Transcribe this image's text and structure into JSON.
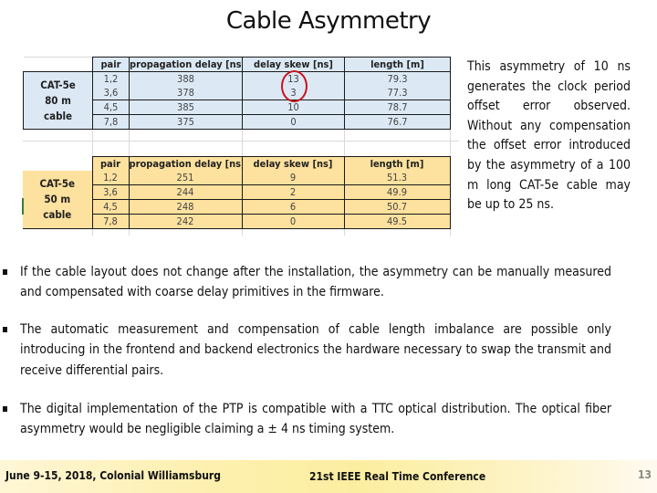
{
  "slide": {
    "title": "Cable Asymmetry",
    "page_number": "13"
  },
  "tables": {
    "cable_80m": {
      "label_lines": [
        "CAT-5e",
        "80 m",
        "cable"
      ],
      "headers": [
        "pair",
        "propagation delay [ns]",
        "delay skew [ns]",
        "length [m]"
      ],
      "rows": [
        {
          "pair": "1,2",
          "propagation_delay": "388",
          "delay_skew": "13",
          "length": "79.3"
        },
        {
          "pair": "3,6",
          "propagation_delay": "378",
          "delay_skew": "3",
          "length": "77.3"
        },
        {
          "pair": "4,5",
          "propagation_delay": "385",
          "delay_skew": "10",
          "length": "78.7"
        },
        {
          "pair": "7,8",
          "propagation_delay": "375",
          "delay_skew": "0",
          "length": "76.7"
        }
      ],
      "highlighted_cells": [
        "13",
        "3"
      ],
      "highlight_color": "#c8141c",
      "fill_color": "#dce9f5"
    },
    "cable_50m": {
      "label_lines": [
        "CAT-5e",
        "50 m",
        "cable"
      ],
      "headers": [
        "pair",
        "propagation delay [ns]",
        "delay skew [ns]",
        "length [m]"
      ],
      "rows": [
        {
          "pair": "1,2",
          "propagation_delay": "251",
          "delay_skew": "9",
          "length": "51.3"
        },
        {
          "pair": "3,6",
          "propagation_delay": "244",
          "delay_skew": "2",
          "length": "49.9"
        },
        {
          "pair": "4,5",
          "propagation_delay": "248",
          "delay_skew": "6",
          "length": "50.7"
        },
        {
          "pair": "7,8",
          "propagation_delay": "242",
          "delay_skew": "0",
          "length": "49.5"
        }
      ],
      "fill_color": "#fde19e"
    }
  },
  "side_note": "This asymmetry of 10 ns generates the clock period offset error observed. Without any compensation the offset error introduced by the asymmetry of a 100 m long CAT-5e cable may be up to 25 ns.",
  "bullets": [
    "If the cable layout does not change after the installation, the asymmetry can be manually measured and compensated with coarse delay primitives in the firmware.",
    "The automatic measurement and compensation of cable length imbalance are possible only introducing in the frontend and backend electronics the hardware necessary to swap the transmit and receive differential pairs.",
    "The digital implementation of the PTP is compatible with a TTC optical distribution. The optical fiber asymmetry would be negligible claiming a ± 4 ns timing system."
  ],
  "footer": {
    "date_location": "June 9-15, 2018, Colonial Williamsburg",
    "conference": "21st IEEE Real Time Conference"
  }
}
